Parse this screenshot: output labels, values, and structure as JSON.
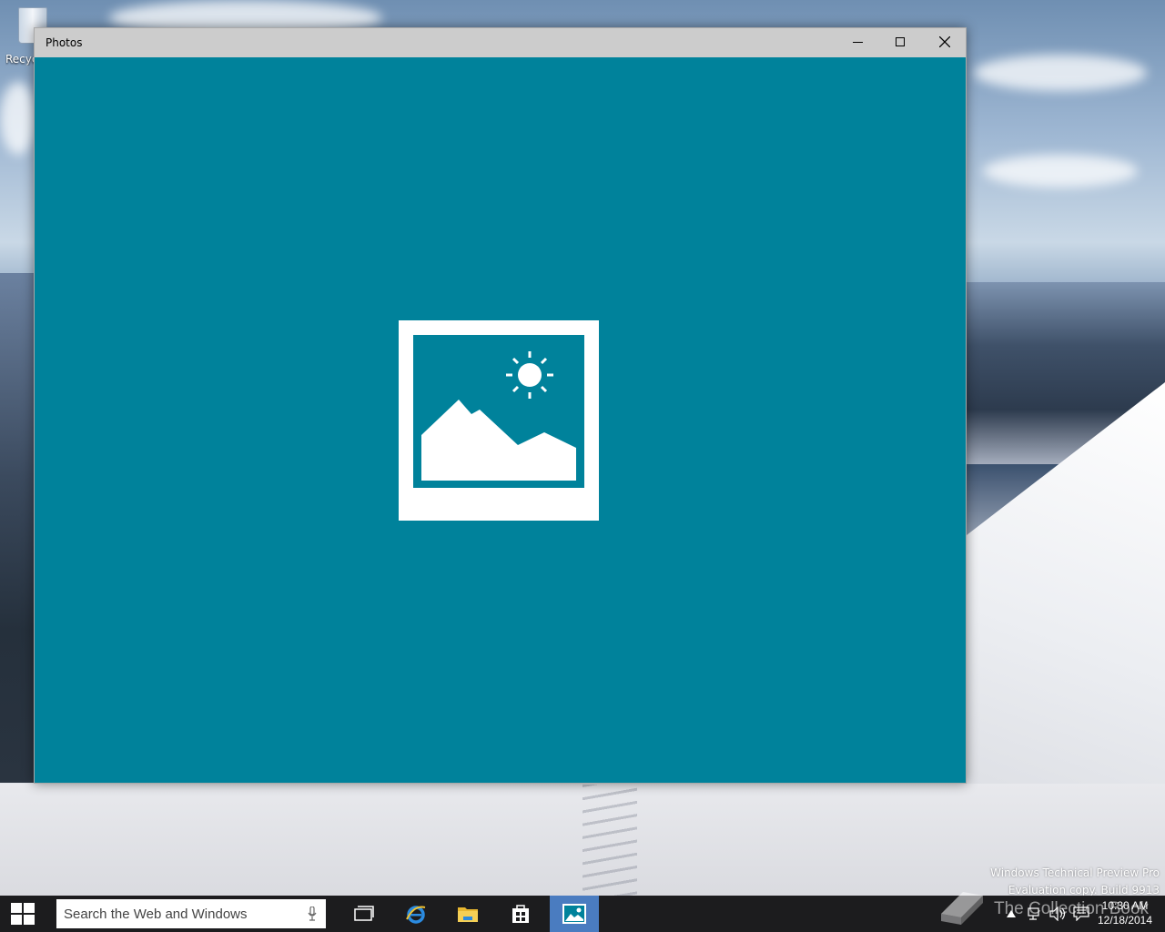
{
  "desktop": {
    "recycle_bin_label": "Recycle Bin",
    "watermark": {
      "line1": "Windows Technical Preview Pro",
      "line2": "Evaluation copy. Build 9913"
    },
    "brand_text": "The Collection Book"
  },
  "window": {
    "title": "Photos",
    "accent_color": "#00829b",
    "titlebar_color": "#cccccc",
    "center_icon": "photos-app-logo-icon"
  },
  "taskbar": {
    "search_placeholder": "Search the Web and Windows",
    "pinned": [
      {
        "name": "task-view",
        "icon": "task-view-icon"
      },
      {
        "name": "internet-explorer",
        "icon": "internet-explorer-icon"
      },
      {
        "name": "file-explorer",
        "icon": "folder-icon"
      },
      {
        "name": "store",
        "icon": "store-icon"
      },
      {
        "name": "photos",
        "icon": "photos-icon",
        "active": true
      }
    ],
    "clock": {
      "time": "10:30 AM",
      "date": "12/18/2014"
    },
    "active_color": "#4a7cc0"
  }
}
